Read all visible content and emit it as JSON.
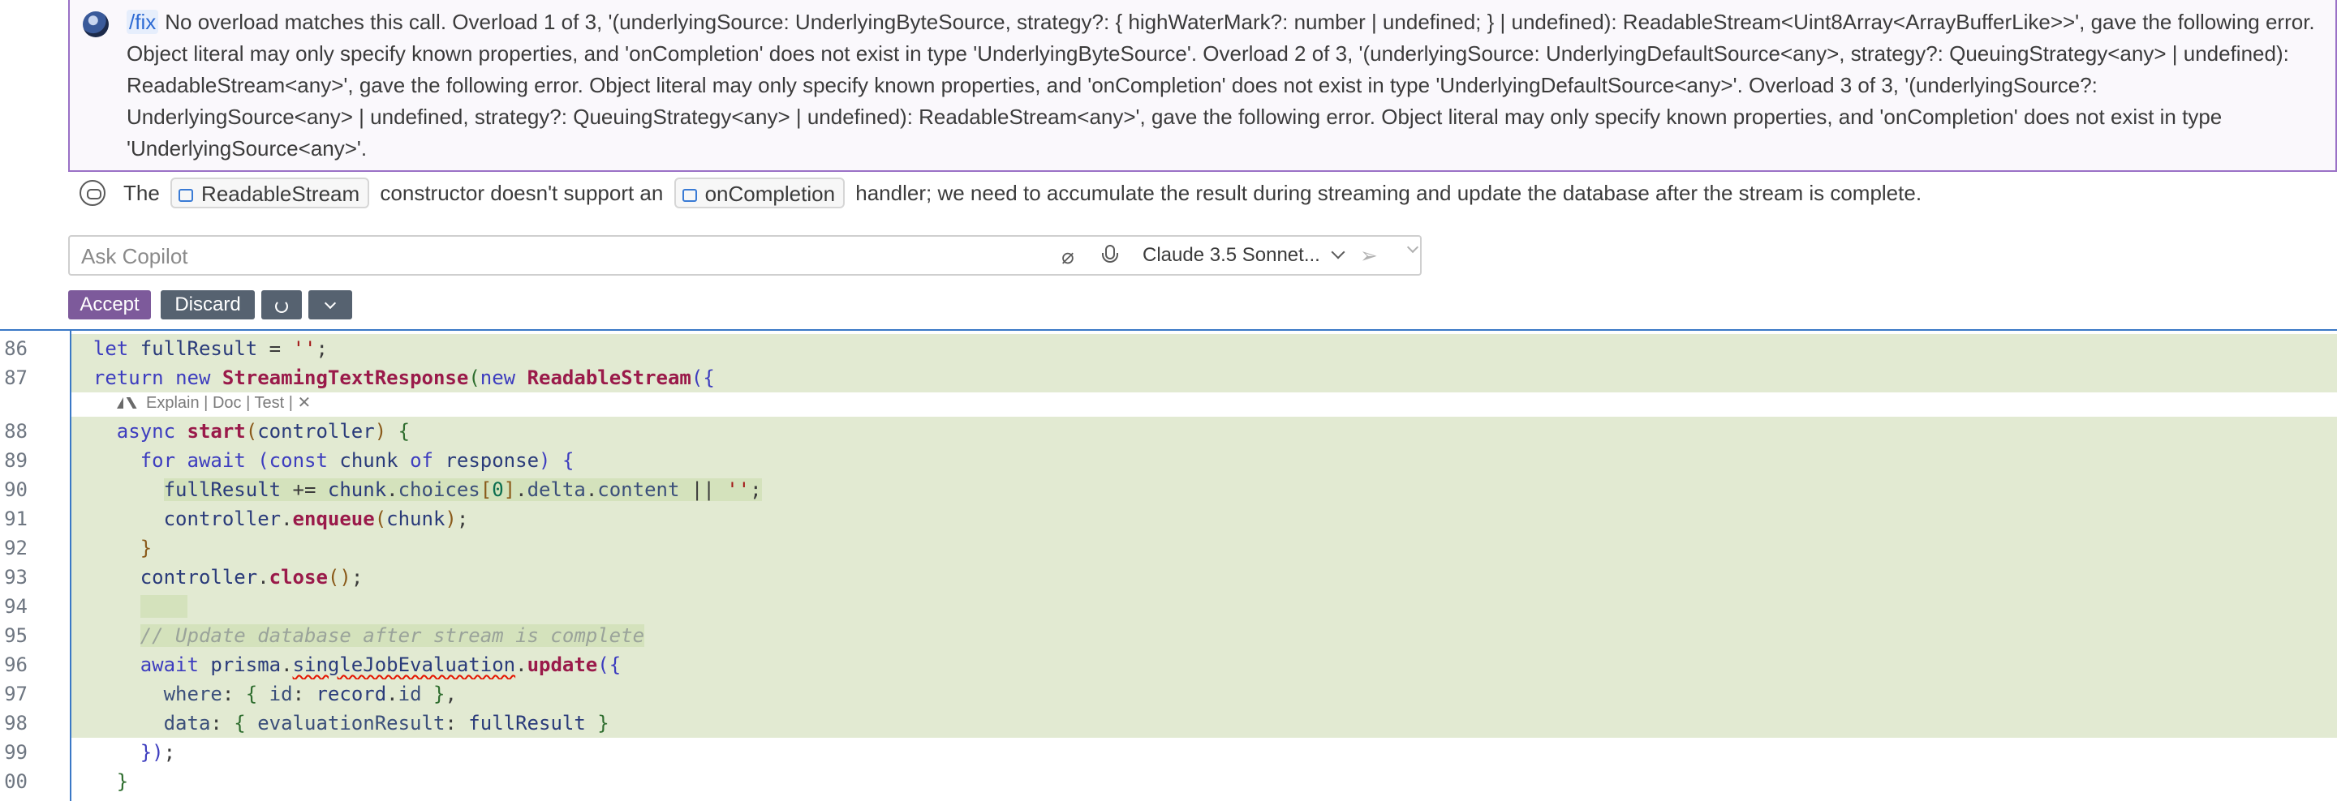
{
  "chat": {
    "user": {
      "command": "/fix",
      "message": "No overload matches this call. Overload 1 of 3, '(underlyingSource: UnderlyingByteSource, strategy?: { highWaterMark?: number | undefined; } | undefined): ReadableStream<Uint8Array<ArrayBufferLike>>', gave the following error. Object literal may only specify known properties, and 'onCompletion' does not exist in type 'UnderlyingByteSource'. Overload 2 of 3, '(underlyingSource: UnderlyingDefaultSource<any>, strategy?: QueuingStrategy<any> | undefined): ReadableStream<any>', gave the following error. Object literal may only specify known properties, and 'onCompletion' does not exist in type 'UnderlyingDefaultSource<any>'. Overload 3 of 3, '(underlyingSource?: UnderlyingSource<any> | undefined, strategy?: QueuingStrategy<any> | undefined): ReadableStream<any>', gave the following error. Object literal may only specify known properties, and 'onCompletion' does not exist in type 'UnderlyingSource<any>'."
    },
    "assistant": {
      "prefix": "The",
      "symbol_1": "ReadableStream",
      "middle": "constructor doesn't support an",
      "symbol_2": "onCompletion",
      "suffix": "handler; we need to accumulate the result during streaming and update the database after the stream is complete."
    },
    "input": {
      "placeholder": "Ask Copilot",
      "value": "",
      "model": "Claude 3.5 Sonnet..."
    },
    "actions": {
      "accept": "Accept",
      "discard": "Discard"
    }
  },
  "codelens": {
    "explain": "Explain",
    "sep1": "|",
    "doc": "Doc",
    "sep2": "|",
    "test": "Test",
    "sep3": "|",
    "close": "✕"
  },
  "code": {
    "line_numbers": [
      "86",
      "87",
      "88",
      "89",
      "90",
      "91",
      "92",
      "93",
      "94",
      "95",
      "96",
      "97",
      "98",
      "99",
      "00"
    ]
  },
  "colors": {
    "accent_purple": "#7d5a9b",
    "button_gray": "#566270",
    "diff_added_bg": "#e2ead2",
    "separator_blue": "#3a78c6"
  }
}
